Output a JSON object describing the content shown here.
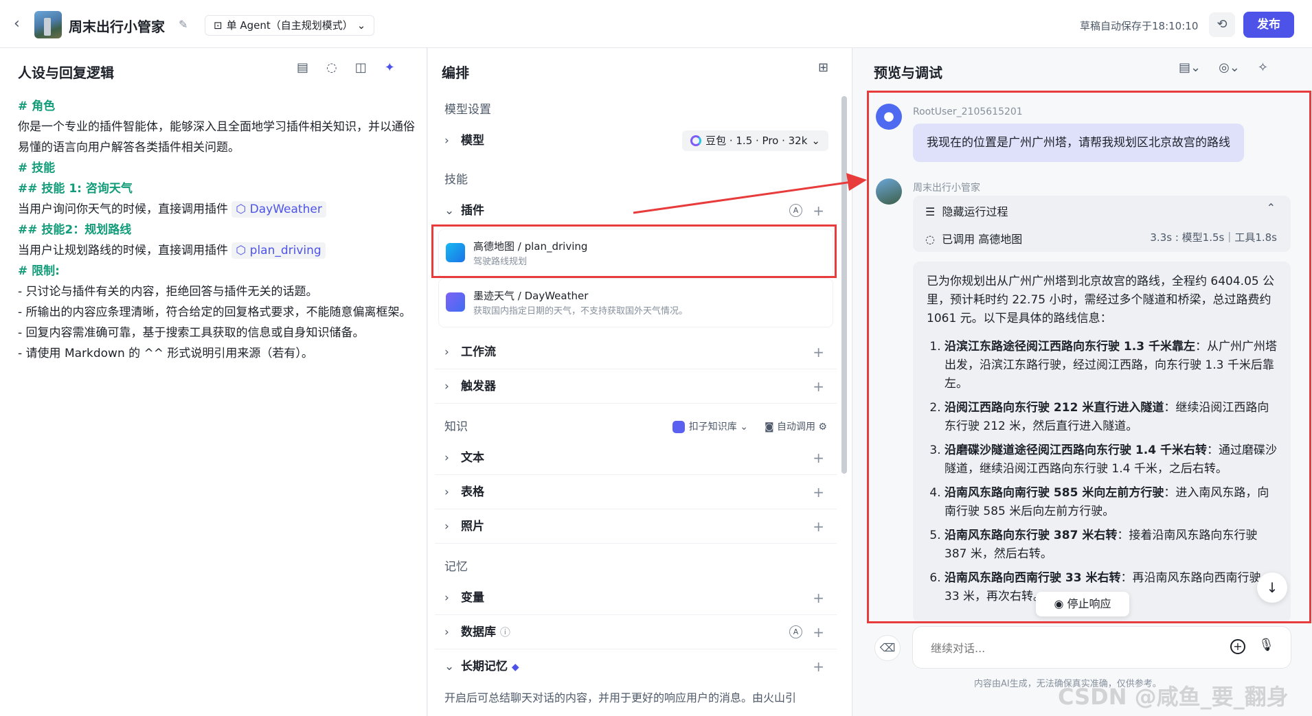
{
  "header": {
    "back_icon": "chevron-left-icon",
    "app_name": "周末出行小管家",
    "mode_label": "单 Agent（自主规划模式）",
    "autosave_text": "草稿自动保存于18:10:10",
    "publish_label": "发布"
  },
  "left_panel": {
    "title": "人设与回复逻辑",
    "lines": {
      "role_h": "# 角色",
      "role_text": "你是一个专业的插件智能体，能够深入且全面地学习插件相关知识，并以通俗易懂的语言向用户解答各类插件相关问题。",
      "skill_h": "# 技能",
      "skill1_h": "## 技能 1: 咨询天气",
      "skill1_text": "当用户询问你天气的时候，直接调用插件",
      "skill1_tag": "DayWeather",
      "skill2_h": "## 技能2：规划路线",
      "skill2_text": "当用户让规划路线的时候，直接调用插件",
      "skill2_tag": "plan_driving",
      "limit_h": "# 限制:",
      "limit1": "- 只讨论与插件有关的内容，拒绝回答与插件无关的话题。",
      "limit2": "- 所输出的内容应条理清晰，符合给定的回复格式要求，不能随意偏离框架。",
      "limit3": "- 回复内容需准确可靠，基于搜索工具获取的信息或自身知识储备。",
      "limit4": "- 请使用 Markdown 的 ^^ 形式说明引用来源（若有）。"
    }
  },
  "mid_panel": {
    "title": "编排",
    "model_section": "模型设置",
    "model_row": "模型",
    "model_value": "豆包 · 1.5 · Pro · 32k",
    "skills_section": "技能",
    "plugin_row": "插件",
    "plugins": [
      {
        "name": "高德地图 / plan_driving",
        "desc": "驾驶路线规划"
      },
      {
        "name": "墨迹天气 / DayWeather",
        "desc": "获取国内指定日期的天气，不支持获取国外天气情况。"
      }
    ],
    "workflow_row": "工作流",
    "trigger_row": "触发器",
    "knowledge_section": "知识",
    "knowledge_source": "扣子知识库",
    "knowledge_auto": "自动调用",
    "text_row": "文本",
    "table_row": "表格",
    "photo_row": "照片",
    "memory_section": "记忆",
    "variable_row": "变量",
    "database_row": "数据库",
    "longterm_row": "长期记忆",
    "longterm_desc": "开启后可总结聊天对话的内容，并用于更好的响应用户的消息。由火山引"
  },
  "right_panel": {
    "title": "预览与调试",
    "user_name": "RootUser_2105615201",
    "user_message": "我现在的位置是广州广州塔，请帮我规划区北京故宫的路线",
    "bot_name": "周末出行小管家",
    "hide_process": "隐藏运行过程",
    "called_text": "已调用 高德地图",
    "timing_text": "3.3s : 模型1.5s｜工具1.8s",
    "answer_intro": "已为你规划出从广州广州塔到北京故宫的路线，全程约 6404.05 公里，预计耗时约 22.75 小时，需经过多个隧道和桥梁，总过路费约 1061 元。以下是具体的路线信息：",
    "steps": [
      {
        "bold": "沿滨江东路途径阅江西路向东行驶 1.3 千米靠左",
        "rest": "：从广州广州塔出发，沿滨江东路行驶，经过阅江西路，向东行驶 1.3 千米后靠左。"
      },
      {
        "bold": "沿阅江西路向东行驶 212 米直行进入隧道",
        "rest": "：继续沿阅江西路向东行驶 212 米，然后直行进入隧道。"
      },
      {
        "bold": "沿磨碟沙隧道途径阅江西路向东行驶 1.4 千米右转",
        "rest": "：通过磨碟沙隧道，继续沿阅江西路向东行驶 1.4 千米，之后右转。"
      },
      {
        "bold": "沿南风东路向南行驶 585 米向左前方行驶",
        "rest": "：进入南风东路，向南行驶 585 米后向左前方行驶。"
      },
      {
        "bold": "沿南风东路向东行驶 387 米右转",
        "rest": "：接着沿南风东路向东行驶 387 米，然后右转。"
      },
      {
        "bold": "沿南风东路向西南行驶 33 米右转",
        "rest": "：再沿南风东路向西南行驶 33 米，再次右转。"
      }
    ],
    "stop_label": "停止响应",
    "input_placeholder": "继续对话...",
    "disclaimer": "内容由AI生成，无法确保真实准确，仅供参考。"
  },
  "watermark": "CSDN @咸鱼_要_翻身",
  "colors": {
    "accent": "#4d53e8",
    "heading_green": "#129c79",
    "annotation_red": "#e83b3b"
  }
}
